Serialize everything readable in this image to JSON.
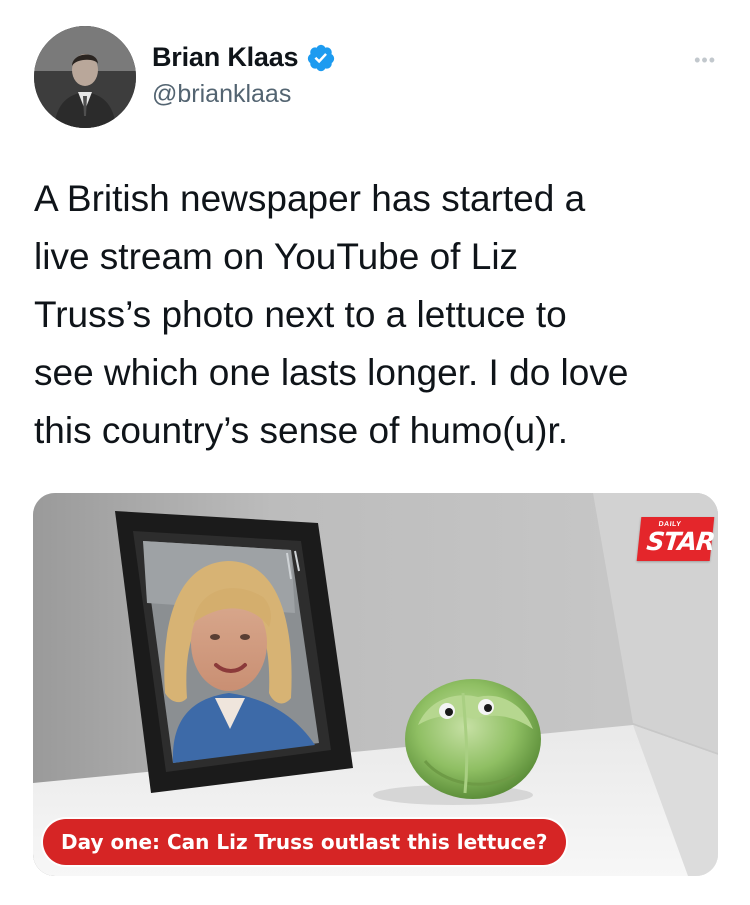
{
  "author": {
    "name": "Brian Klaas",
    "handle": "@brianklaas",
    "verified": true,
    "avatar_icon": "profile-photo"
  },
  "menu": {
    "label": "•••"
  },
  "tweet": {
    "text": "A British newspaper has started a\nlive stream on YouTube of Liz\nTruss’s photo next to a lettuce to\nsee which one lasts longer. I do love\nthis country’s sense of humo(u)r."
  },
  "media": {
    "brand_small": "DAILY",
    "brand_big": "STAR",
    "caption": "Day one: Can Liz Truss outlast this lettuce?"
  },
  "colors": {
    "verified_blue": "#1d9bf0",
    "caption_red": "#d62525",
    "brand_red": "#e4262b",
    "secondary_text": "#536471"
  }
}
